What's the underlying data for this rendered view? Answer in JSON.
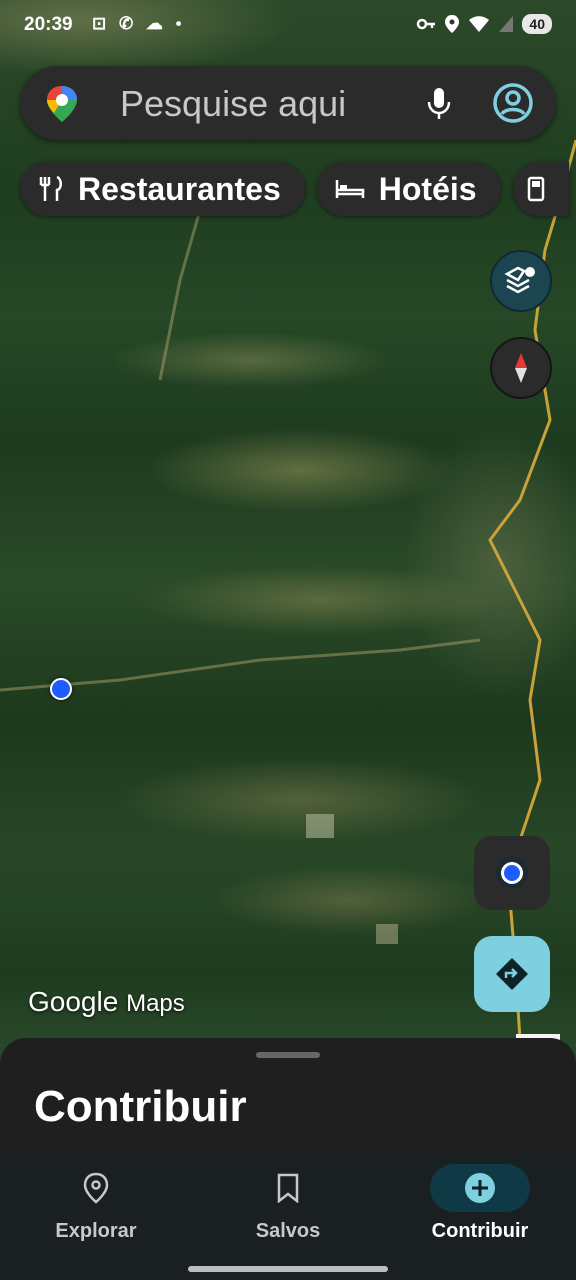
{
  "status_bar": {
    "time": "20:39",
    "left_icons": "⊡ ✆ ☁ •",
    "battery": "40"
  },
  "search": {
    "placeholder": "Pesquise aqui"
  },
  "chips": [
    {
      "label": "Restaurantes",
      "icon": "fork-knife-icon"
    },
    {
      "label": "Hotéis",
      "icon": "bed-icon"
    },
    {
      "label": "",
      "icon": "gas-station-icon"
    }
  ],
  "watermark": {
    "google": "Google",
    "maps": "Maps"
  },
  "sheet": {
    "title": "Contribuir"
  },
  "nav": {
    "items": [
      {
        "label": "Explorar",
        "icon": "location-pin-icon",
        "active": false
      },
      {
        "label": "Salvos",
        "icon": "bookmark-icon",
        "active": false
      },
      {
        "label": "Contribuir",
        "icon": "add-circle-icon",
        "active": true
      }
    ]
  },
  "colors": {
    "accent": "#7ecfe0",
    "location_dot": "#1f5cff",
    "active_nav": "#0f3a45"
  }
}
